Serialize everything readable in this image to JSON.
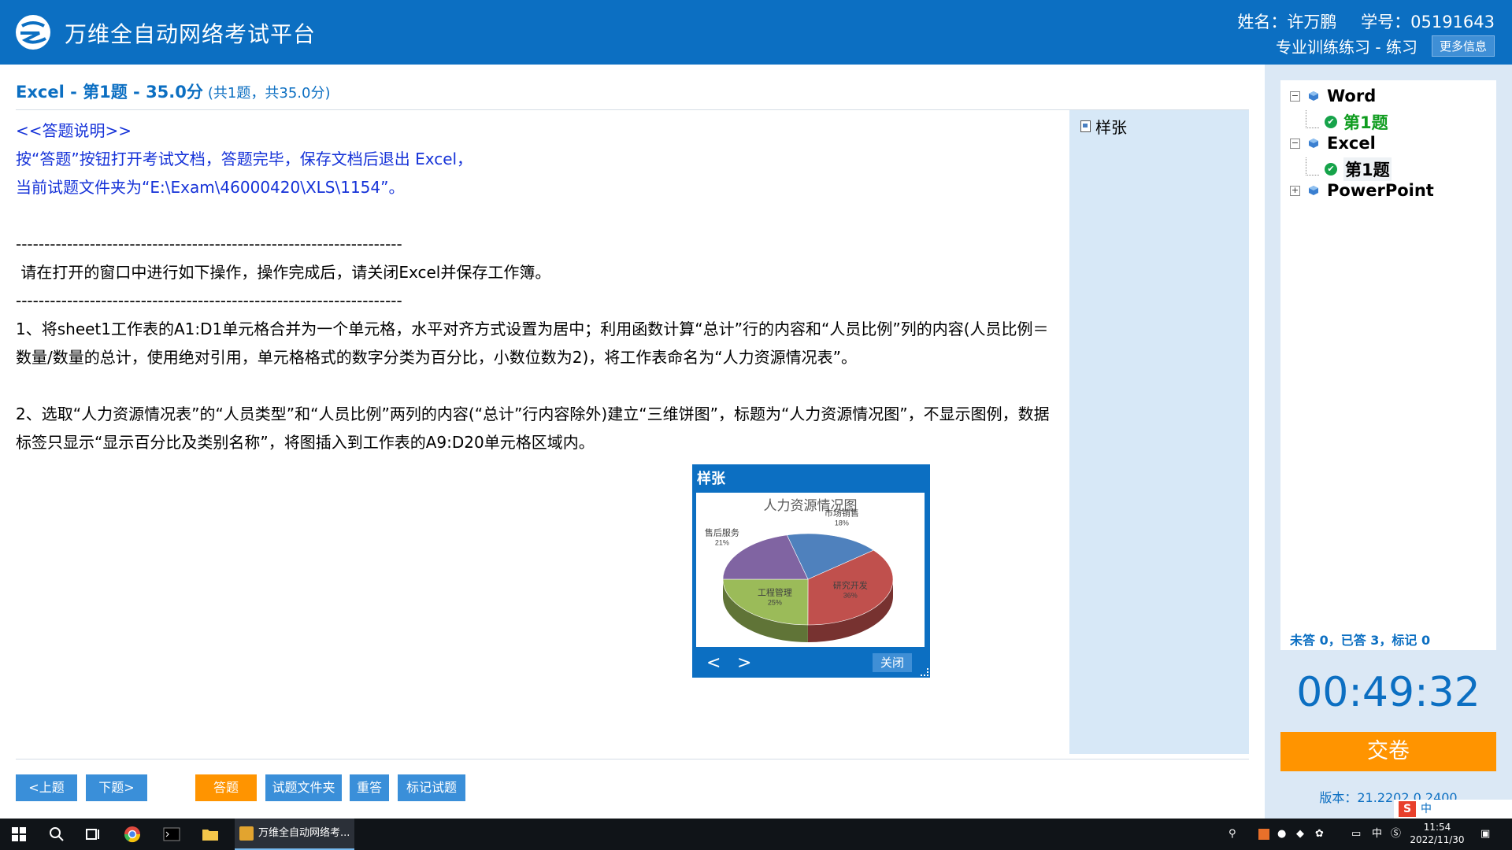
{
  "header": {
    "app_title": "万维全自动网络考试平台",
    "name_label": "姓名：许万鹏",
    "id_label": "学号：05191643",
    "mode_label": "专业训练练习 - 练习",
    "more_button": "更多信息"
  },
  "question": {
    "title": "Excel - 第1题 - 35.0分",
    "subtitle": "(共1题，共35.0分)"
  },
  "content": {
    "instructions_heading": "<<答题说明>>",
    "instruction_line1": "按“答题”按钮打开考试文档，答题完毕，保存文档后退出 Excel，",
    "instruction_line2": "当前试题文件夹为“E:\\Exam\\46000420\\XLS\\1154”。",
    "dash_line": "--------------------------------------------------------------------",
    "task_intro": " 请在打开的窗口中进行如下操作，操作完成后，请关闭Excel并保存工作簿。",
    "task1": "1、将sheet1工作表的A1:D1单元格合并为一个单元格，水平对齐方式设置为居中；利用函数计算“总计”行的内容和“人员比例”列的内容(人员比例＝数量/数量的总计，使用绝对引用，单元格格式的数字分类为百分比，小数位数为2)，将工作表命名为“人力资源情况表”。",
    "task2": "2、选取“人力资源情况表”的“人员类型”和“人员比例”两列的内容(“总计”行内容除外)建立“三维饼图”，标题为“人力资源情况图”，不显示图例，数据标签只显示“显示百分比及类别名称”，将图插入到工作表的A9:D20单元格区域内。"
  },
  "sample_panel": {
    "link_label": "样张"
  },
  "popup": {
    "title": "样张",
    "prev": "<",
    "next": ">",
    "close": "关闭"
  },
  "chart_data": {
    "type": "pie",
    "title": "人力资源情况图",
    "three_d": true,
    "legend": "none",
    "slices": [
      {
        "label": "市场销售",
        "value_label": "18%",
        "value": 18,
        "color": "#4f81bd"
      },
      {
        "label": "研究开发",
        "value_label": "36%",
        "value": 36,
        "color": "#c0504d"
      },
      {
        "label": "工程管理",
        "value_label": "25%",
        "value": 25,
        "color": "#9bbb59"
      },
      {
        "label": "售后服务",
        "value_label": "21%",
        "value": 21,
        "color": "#8064a2"
      }
    ]
  },
  "buttons": {
    "prev": "<上题",
    "next": "下题>",
    "answer": "答题",
    "folder": "试题文件夹",
    "redo": "重答",
    "mark": "标记试题"
  },
  "tree": {
    "word": "Word",
    "word_q1": "第1题",
    "excel": "Excel",
    "excel_q1": "第1题",
    "ppt": "PowerPoint"
  },
  "status": {
    "stats": "未答 0，已答 3，标记 0",
    "timer": "00:49:32",
    "submit": "交卷",
    "version": "版本：21.2202.0.2400"
  },
  "taskbar": {
    "app_label": "万维全自动网络考...",
    "ime_label": "中",
    "time": "11:54",
    "date": "2022/11/30"
  }
}
